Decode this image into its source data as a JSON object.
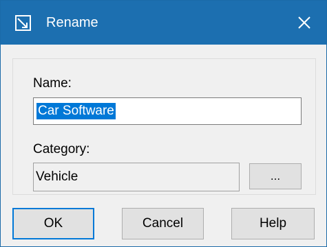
{
  "window": {
    "title": "Rename",
    "title_icon": "rename-icon",
    "close_icon": "close-icon"
  },
  "form": {
    "name_label": "Name:",
    "name_value": "Car Software",
    "category_label": "Category:",
    "category_value": "Vehicle",
    "browse_label": "..."
  },
  "buttons": {
    "ok": "OK",
    "cancel": "Cancel",
    "help": "Help"
  },
  "colors": {
    "titlebar": "#1c6fb0",
    "selection": "#0078d7",
    "default_button_border": "#0078d7"
  }
}
